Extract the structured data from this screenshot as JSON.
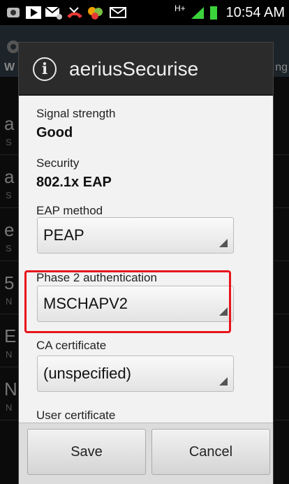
{
  "status_bar": {
    "time": "10:54 AM",
    "network_label": "H+",
    "icons": [
      "gear-app-icon",
      "play-store-icon",
      "mail-icon",
      "missed-call-icon",
      "puzzle-icon",
      "envelope-icon"
    ]
  },
  "background": {
    "header_letter": "W",
    "header_suffix": "ng",
    "rows": [
      {
        "letter": "a",
        "sub": "S"
      },
      {
        "letter": "a",
        "sub": "S"
      },
      {
        "letter": "e",
        "sub": "S"
      },
      {
        "letter": "5",
        "sub": "N"
      },
      {
        "letter": "E",
        "sub": "N"
      },
      {
        "letter": "N",
        "sub": "N"
      }
    ]
  },
  "dialog": {
    "title": "aeriusSecurise",
    "signal_strength_label": "Signal strength",
    "signal_strength_value": "Good",
    "security_label": "Security",
    "security_value": "802.1x EAP",
    "eap_method_label": "EAP method",
    "eap_method_value": "PEAP",
    "phase2_label": "Phase 2 authentication",
    "phase2_value": "MSCHAPV2",
    "ca_cert_label": "CA certificate",
    "ca_cert_value": "(unspecified)",
    "user_cert_label": "User certificate",
    "save_label": "Save",
    "cancel_label": "Cancel"
  },
  "colors": {
    "highlight": "#e8141b",
    "battery": "#3cd23c",
    "signal": "#3cd23c"
  }
}
